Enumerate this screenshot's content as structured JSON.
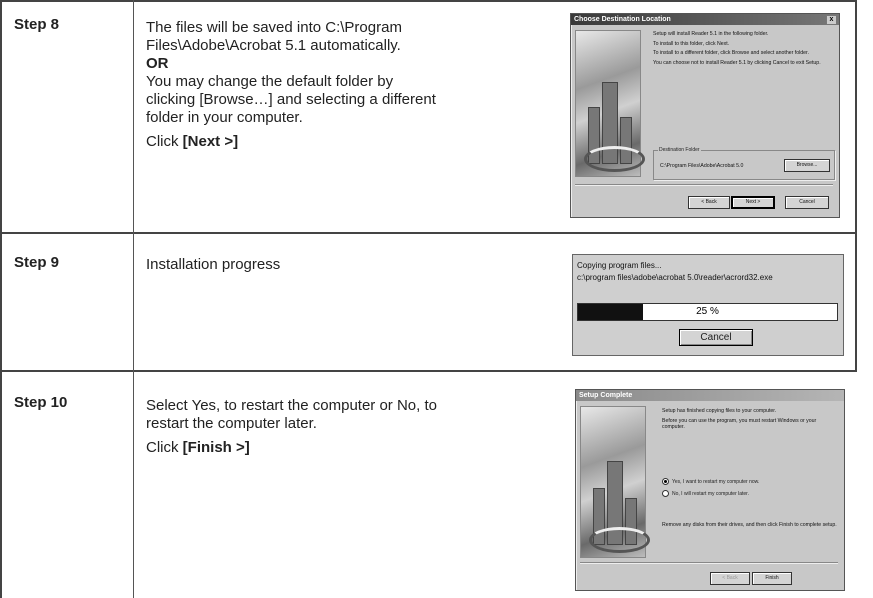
{
  "rows": [
    {
      "step": "Step 8",
      "line1": "The files will be saved into C:\\Program",
      "line2": "Files\\Adobe\\Acrobat 5.1 automatically.",
      "or": "OR",
      "line3": "You may change the default folder by",
      "line4": "clicking [Browse…] and selecting a different",
      "line5": "folder in your computer.",
      "click_prefix": "Click ",
      "click_bold": "[Next >]"
    },
    {
      "step": "Step 9",
      "line1": "Installation progress"
    },
    {
      "step": "Step 10",
      "line1": "Select Yes, to restart the computer or No, to",
      "line2": "restart the computer later.",
      "click_prefix": "Click ",
      "click_bold": "[Finish >]"
    }
  ],
  "dialog_dest": {
    "title": "Choose Destination Location",
    "close": "x",
    "p1": "Setup will install Reader 5.1 in the following folder.",
    "p2": "To install to this folder, click Next.",
    "p3": "To install to a different folder, click Browse and select another folder.",
    "p4": "You can choose not to install Reader 5.1 by clicking Cancel to exit Setup.",
    "group_label": "Destination Folder",
    "folder": "C:\\Program Files\\Adobe\\Acrobat 5.0",
    "browse": "Browse...",
    "back": "< Back",
    "next": "Next >",
    "cancel": "Cancel"
  },
  "dialog_progress": {
    "line1": "Copying program files...",
    "line2": "c:\\program files\\adobe\\acrobat 5.0\\reader\\acrord32.exe",
    "percent_text": "25 %",
    "progress": 0.25,
    "cancel": "Cancel"
  },
  "dialog_complete": {
    "title": "Setup Complete",
    "p1": "Setup has finished copying files to your computer.",
    "p2": "Before you can use the program, you must restart Windows or your computer.",
    "radio_yes": "Yes, I want to restart my computer now.",
    "radio_no": "No, I will restart my computer later.",
    "p3": "Remove any disks from their drives, and then click Finish to complete setup.",
    "back": "< Back",
    "finish": "Finish"
  }
}
